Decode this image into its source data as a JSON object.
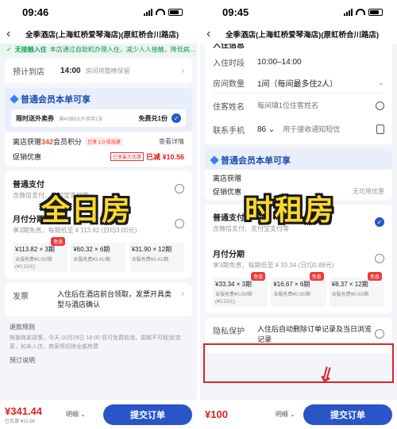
{
  "left": {
    "time": "09:46",
    "title": "全季酒店(上海虹桥爱琴海店)(原虹桥合川路店)",
    "banner": {
      "head": "无接触入住",
      "text": "本店通过自助机办理入住，减少人人接触，降低病..."
    },
    "arrival": {
      "label": "预计到店",
      "value": "14:00",
      "hint": "房间将整晚保留"
    },
    "member": {
      "title": "普通会员本单可享",
      "promo_tag": "限时送外卖券",
      "promo_desc": "满40减8元外卖券1张",
      "promo_value": "免费兑1份",
      "points_label": "离店获赠",
      "points_value": "342",
      "points_unit": "会员积分",
      "points_badge": "已享 1.0 倍加速",
      "points_link": "查看详情",
      "discount_label": "促销优惠",
      "discount_badge": "已享最大优惠",
      "discount_value": "已减 ¥10.56"
    },
    "pay_normal": {
      "title": "普通支付",
      "sub": "含微信支付、支付宝支付等"
    },
    "installment": {
      "title": "月付分期",
      "sub": "享3期免息，每期低至 ¥ 113.82 (日均3.00元)",
      "options": [
        {
          "main": "¥113.82 × 3期",
          "sub": "含服务费¥0.00/期(¥0.23元)",
          "tag": "免息"
        },
        {
          "main": "¥60.32 × 6期",
          "sub": "含服务费¥3.41/期",
          "tag": ""
        },
        {
          "main": "¥31.90 × 12期",
          "sub": "含服务费¥3.41/期",
          "tag": ""
        }
      ]
    },
    "invoice": {
      "label": "发票",
      "text": "入住后在酒店前台领取，发票开具类型与酒店确认"
    },
    "refund": {
      "title": "退款规则",
      "text": "根据商家政策，今天 10月29日 18:00 前可免费取消，逾期不可取消/变更，如未入住，商家将扣除全部房费"
    },
    "notice": "预订说明",
    "price": "¥341.44",
    "price_sub": "已优惠 ¥10.56",
    "detail": "明细",
    "submit": "提交订单",
    "overlay": "全日房"
  },
  "right": {
    "time": "09:45",
    "title": "全季酒店(上海虹桥爱琴海店)(原虹桥合川路店)",
    "section": "入住信息",
    "checkin": {
      "label": "入住时段",
      "value": "10:00–14:00"
    },
    "rooms": {
      "label": "房间数量",
      "value": "1间（每间最多住2人）"
    },
    "guest": {
      "label": "住客姓名",
      "placeholder": "每间填1位住客姓名"
    },
    "phone": {
      "label": "联系手机",
      "code": "86",
      "placeholder": "用于接收通知短信"
    },
    "member": {
      "title": "普通会员本单可享",
      "points_label": "离店获赠",
      "discount_label": "促销优惠",
      "discount_note": "无可用优惠"
    },
    "pay_normal": {
      "title": "普通支付",
      "sub": "含微信支付、支付宝支付等"
    },
    "installment": {
      "title": "月付分期",
      "sub": "享3期免息，每期低至 ¥ 33.34 (日均0.88元)",
      "options": [
        {
          "main": "¥33.34 × 3期",
          "sub": "含服务费¥0.00/期(¥0.23元)",
          "tag": "免息"
        },
        {
          "main": "¥16.67 × 6期",
          "sub": "含服务费¥0.00/期",
          "tag": "免息"
        },
        {
          "main": "¥8.37 × 12期",
          "sub": "含服务费¥0.00/期",
          "tag": "免息"
        }
      ]
    },
    "privacy": {
      "label": "隐私保护",
      "text": "入住后自动删除订单记录及当日浏览记录"
    },
    "price": "¥100",
    "detail": "明细",
    "submit": "提交订单",
    "overlay": "时租房"
  }
}
